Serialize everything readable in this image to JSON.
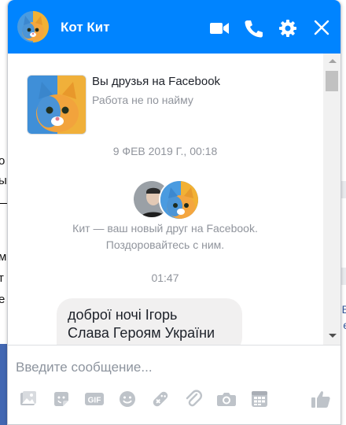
{
  "background": {
    "left_fragments": [
      "о",
      "ы",
      "м",
      "т",
      "е"
    ],
    "right_fragments": [
      "t",
      "B",
      "e"
    ]
  },
  "chat": {
    "header": {
      "title": "Кот Кит",
      "buttons": [
        "video-call-icon",
        "phone-call-icon",
        "settings-gear-icon",
        "close-icon"
      ],
      "background_color": "#0084ff"
    },
    "intro": {
      "title": "Вы друзья на Facebook",
      "subtitle": "Работа не по найму"
    },
    "timestamp_1": "9 ФЕВ 2019 Г., 00:18",
    "friend_note_line1": "Кит — ваш новый друг на Facebook.",
    "friend_note_line2": "Поздоровайтесь с ним.",
    "timestamp_2": "01:47",
    "message": {
      "line1": "доброї ночі Ігорь",
      "line2": "Слава Героям України"
    },
    "composer": {
      "placeholder": "Введите сообщение...",
      "value": "",
      "tools": [
        "photo-icon",
        "sticker-icon",
        "gif-icon",
        "emoji-icon",
        "game-icon",
        "attachment-icon",
        "camera-icon",
        "plan-icon",
        "like-icon"
      ]
    },
    "tool_color": "#bec3c9"
  }
}
